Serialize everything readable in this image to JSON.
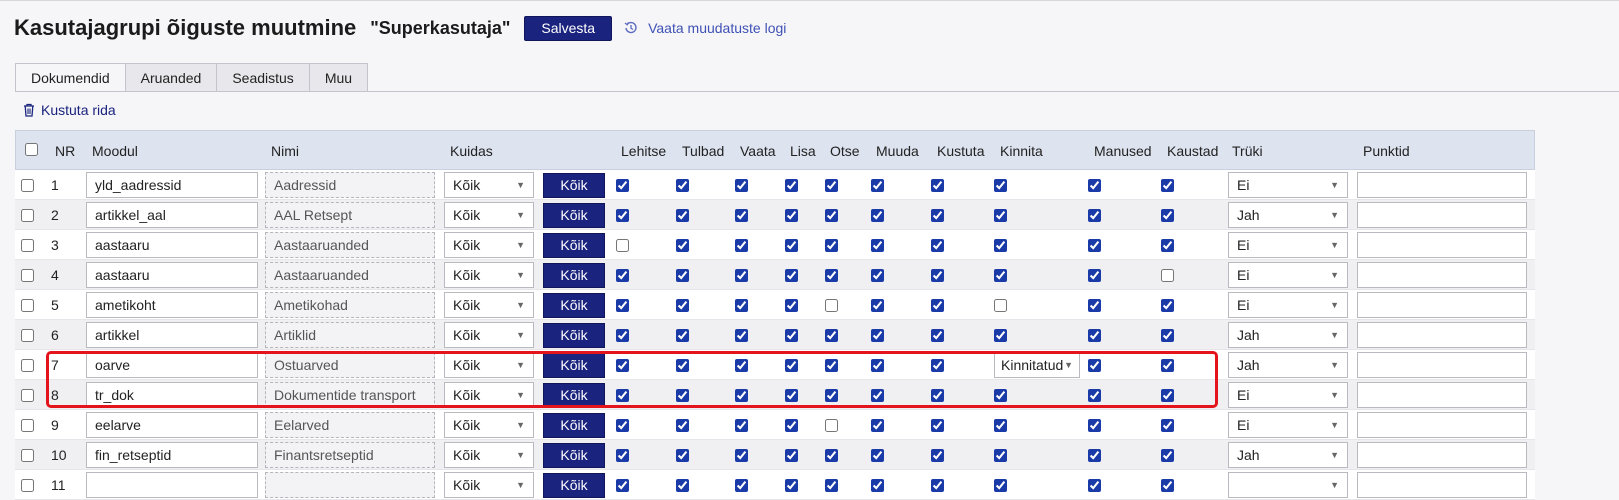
{
  "header": {
    "title": "Kasutajagrupi õiguste muutmine",
    "record_name": "\"Superkasutaja\"",
    "save_label": "Salvesta",
    "log_label": "Vaata muudatuste logi"
  },
  "tabs": [
    "Dokumendid",
    "Aruanded",
    "Seadistus",
    "Muu"
  ],
  "actions": {
    "delete_label": "Kustuta rida"
  },
  "columns": {
    "nr": "NR",
    "module": "Moodul",
    "name": "Nimi",
    "how": "Kuidas",
    "browse": "Lehitse",
    "columns": "Tulbad",
    "view": "Vaata",
    "add": "Lisa",
    "search": "Otse",
    "edit": "Muuda",
    "delete": "Kustuta",
    "confirm": "Kinnita",
    "attachments": "Manused",
    "folders": "Kaustad",
    "print": "Trüki",
    "points": "Punktid"
  },
  "all_button_label": "Kõik",
  "rows": [
    {
      "nr": "1",
      "module": "yld_aadressid",
      "name": "Aadressid",
      "how": "Kõik",
      "perms": [
        true,
        true,
        true,
        true,
        true,
        true,
        true,
        true,
        true,
        true
      ],
      "confirm_select": "",
      "print": "Ei"
    },
    {
      "nr": "2",
      "module": "artikkel_aal",
      "name": "AAL Retsept",
      "how": "Kõik",
      "perms": [
        true,
        true,
        true,
        true,
        true,
        true,
        true,
        true,
        true,
        true
      ],
      "confirm_select": "",
      "print": "Jah"
    },
    {
      "nr": "3",
      "module": "aastaaru",
      "name": "Aastaaruanded",
      "how": "Kõik",
      "perms": [
        false,
        true,
        true,
        true,
        true,
        true,
        true,
        true,
        true,
        true
      ],
      "confirm_select": "",
      "print": "Ei"
    },
    {
      "nr": "4",
      "module": "aastaaru",
      "name": "Aastaaruanded",
      "how": "Kõik",
      "perms": [
        true,
        true,
        true,
        true,
        true,
        true,
        true,
        true,
        true,
        false
      ],
      "confirm_select": "",
      "print": "Ei"
    },
    {
      "nr": "5",
      "module": "ametikoht",
      "name": "Ametikohad",
      "how": "Kõik",
      "perms": [
        true,
        true,
        true,
        true,
        false,
        true,
        true,
        false,
        true,
        true
      ],
      "confirm_select": "",
      "print": "Ei"
    },
    {
      "nr": "6",
      "module": "artikkel",
      "name": "Artiklid",
      "how": "Kõik",
      "perms": [
        true,
        true,
        true,
        true,
        true,
        true,
        true,
        true,
        true,
        true
      ],
      "confirm_select": "",
      "print": "Jah"
    },
    {
      "nr": "7",
      "module": "oarve",
      "name": "Ostuarved",
      "how": "Kõik",
      "perms": [
        true,
        true,
        true,
        true,
        true,
        true,
        true,
        true,
        true,
        true
      ],
      "confirm_select": "Kinnitatud",
      "print": "Jah"
    },
    {
      "nr": "8",
      "module": "tr_dok",
      "name": "Dokumentide transport",
      "how": "Kõik",
      "perms": [
        true,
        true,
        true,
        true,
        true,
        true,
        true,
        true,
        true,
        true
      ],
      "confirm_select": "",
      "print": "Ei"
    },
    {
      "nr": "9",
      "module": "eelarve",
      "name": "Eelarved",
      "how": "Kõik",
      "perms": [
        true,
        true,
        true,
        true,
        false,
        true,
        true,
        true,
        true,
        true
      ],
      "confirm_select": "",
      "print": "Ei"
    },
    {
      "nr": "10",
      "module": "fin_retseptid",
      "name": "Finantsretseptid",
      "how": "Kõik",
      "perms": [
        true,
        true,
        true,
        true,
        true,
        true,
        true,
        true,
        true,
        true
      ],
      "confirm_select": "",
      "print": "Jah"
    },
    {
      "nr": "11",
      "module": "",
      "name": "",
      "how": "Kõik",
      "perms": [
        true,
        true,
        true,
        true,
        true,
        true,
        true,
        true,
        true,
        true
      ],
      "confirm_select": "",
      "print": ""
    }
  ],
  "colors": {
    "accent": "#1a237e",
    "highlight": "#e3141b",
    "link": "#3f51b5"
  }
}
